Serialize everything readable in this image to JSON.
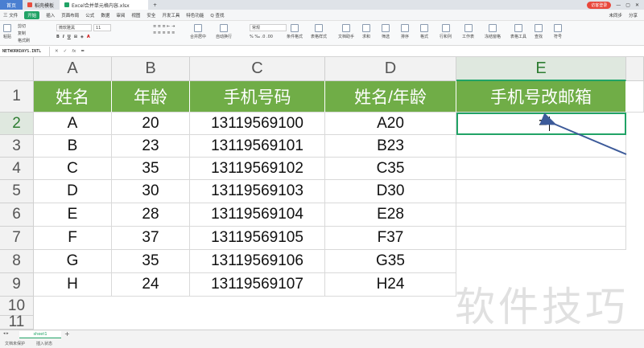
{
  "titlebar": {
    "tabs": [
      "首页",
      "稻壳模板",
      "Excel合并单元格内容.xlsx"
    ],
    "login": "访客登录"
  },
  "menu": {
    "items": [
      "三 文件",
      "开始",
      "插入",
      "页面布局",
      "公式",
      "数据",
      "审阅",
      "视图",
      "安全",
      "开发工具",
      "特色功能",
      "Q 查找"
    ],
    "right": [
      "未同步",
      "分享"
    ]
  },
  "ribbon": {
    "font": "微软雅黑",
    "size": "11",
    "format": "常规",
    "groups": [
      "粘贴",
      "剪切",
      "复制",
      "格式刷",
      "合并居中",
      "自动换行",
      "条件格式",
      "表格样式",
      "文档助手",
      "求和",
      "筛选",
      "排序",
      "格式",
      "行和列",
      "工作表",
      "冻结窗格",
      "表格工具",
      "查找",
      "符号"
    ]
  },
  "formula_bar": {
    "namebox": "NETWORKDAYS.INTL",
    "fx": "fx",
    "content": "="
  },
  "columns": [
    "A",
    "B",
    "C",
    "D",
    "E"
  ],
  "rows": [
    "1",
    "2",
    "3",
    "4",
    "5",
    "6",
    "7",
    "8",
    "9",
    "10",
    "11"
  ],
  "header": [
    "姓名",
    "年龄",
    "手机号码",
    "姓名/年龄",
    "手机号改邮箱"
  ],
  "data": [
    [
      "A",
      "20",
      "13119569100",
      "A20"
    ],
    [
      "B",
      "23",
      "13119569101",
      "B23"
    ],
    [
      "C",
      "35",
      "13119569102",
      "C35"
    ],
    [
      "D",
      "30",
      "13119569103",
      "D30"
    ],
    [
      "E",
      "28",
      "13119569104",
      "E28"
    ],
    [
      "F",
      "37",
      "13119569105",
      "F37"
    ],
    [
      "G",
      "35",
      "13119569106",
      "G35"
    ],
    [
      "H",
      "24",
      "13119569107",
      "H24"
    ]
  ],
  "active_cell_text": "=",
  "sheet_tab": "sheet1",
  "status": [
    "文档未保护",
    "插入状态"
  ],
  "watermark": "软件技巧",
  "colors": {
    "header_green": "#70ad47",
    "accent": "#21a366",
    "arrow": "#3c5a99"
  }
}
